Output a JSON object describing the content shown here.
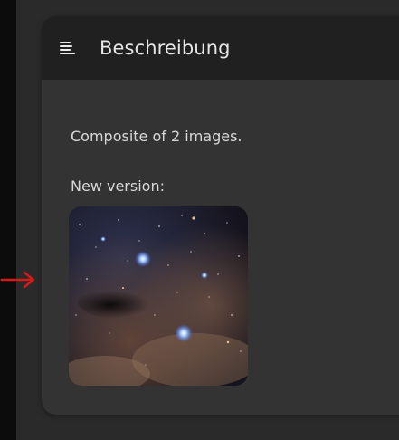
{
  "description_panel": {
    "title": "Beschreibung",
    "icon": "text-lines-icon"
  },
  "body": {
    "line1": "Composite of 2 images.",
    "line2": "New version:"
  },
  "thumbnail": {
    "alt": "Starfield nebula photo"
  },
  "annotations": {
    "arrow_icon": "red-arrow-icon",
    "arrow_color": "#d61a1a"
  },
  "colors": {
    "page_background": "#0c0c0c",
    "panel_background": "#2a2a2a",
    "card_background": "#333333",
    "header_background": "#202020",
    "text_color": "#d8d8d8"
  }
}
